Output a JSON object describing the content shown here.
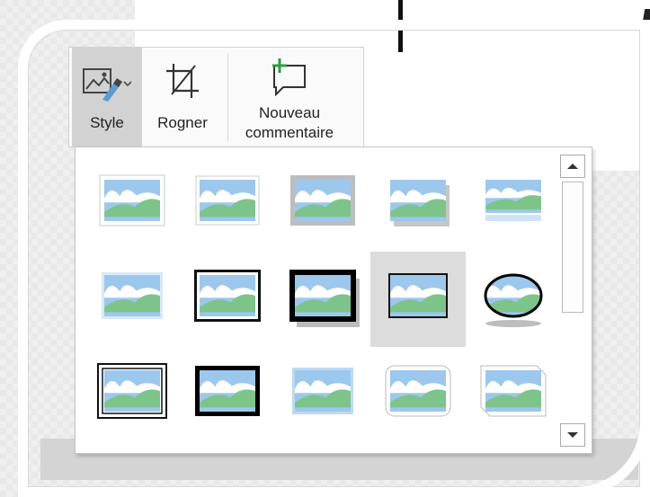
{
  "ribbon": {
    "style_label": "Style",
    "crop_label": "Rogner",
    "comment_label_1": "Nouveau",
    "comment_label_2": "commentaire"
  },
  "gallery": {
    "rows": 3,
    "columns": 5,
    "selected_index": 8,
    "styles": [
      "simple-frame-white",
      "soft-edge-rectangle",
      "drop-shadow-rectangle",
      "perspective-shadow",
      "reflected-rounded-rectangle",
      "soft-edge-glow",
      "double-frame-black",
      "thick-matte-black",
      "simple-frame-black",
      "oval-shadow",
      "compound-frame-black",
      "center-shadow-rectangle",
      "moderate-frame-white",
      "rounded-diagonal-corner",
      "snip-diagonal-corner"
    ]
  },
  "colors": {
    "sky": "#9cc8ee",
    "hill": "#7dc48a",
    "selected_bg": "#dcdcdc",
    "comment_plus": "#2e9e3e"
  }
}
